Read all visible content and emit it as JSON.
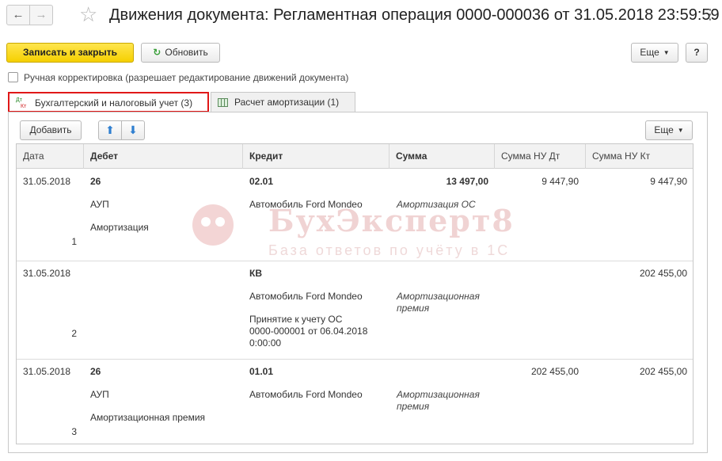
{
  "window": {
    "title": "Движения документа: Регламентная операция 0000-000036 от 31.05.2018 23:59:59",
    "nav_back": "←",
    "nav_forward": "→",
    "star": "☆",
    "close": "⋮"
  },
  "toolbar": {
    "save_close": "Записать и закрыть",
    "refresh": "Обновить",
    "refresh_icon": "↻",
    "more": "Еще",
    "help": "?"
  },
  "manual_edit": {
    "checked": false,
    "label": "Ручная корректировка (разрешает редактирование движений документа)"
  },
  "tabs": [
    {
      "label": "Бухгалтерский и налоговый учет (3)",
      "icon_dt": "Дт",
      "icon_kt": "Кт",
      "active": true
    },
    {
      "label": "Расчет амортизации (1)",
      "active": false
    }
  ],
  "table_toolbar": {
    "add": "Добавить",
    "up": "⬆",
    "down": "⬇",
    "more": "Еще"
  },
  "columns": [
    "Дата",
    "Дебет",
    "Кредит",
    "Сумма",
    "Сумма НУ Дт",
    "Сумма НУ Кт"
  ],
  "rows": [
    {
      "date": "31.05.2018",
      "num": "1",
      "debit": "26",
      "debit_sub1": "АУП",
      "debit_sub2": "Амортизация",
      "credit": "02.01",
      "credit_sub1": "Автомобиль Ford Mondeo",
      "credit_sub2": "",
      "sum": "13 497,00",
      "sum_note": "Амортизация ОС",
      "nu_dt": "9 447,90",
      "nu_kt": "9 447,90"
    },
    {
      "date": "31.05.2018",
      "num": "2",
      "debit": "",
      "debit_sub1": "",
      "debit_sub2": "",
      "credit": "КВ",
      "credit_sub1": "Автомобиль Ford Mondeo",
      "credit_sub2_l1": "Принятие к учету ОС",
      "credit_sub2_l2": "0000-000001 от 06.04.2018",
      "credit_sub2_l3": "0:00:00",
      "sum": "",
      "sum_note_l1": "Амортизационная",
      "sum_note_l2": "премия",
      "nu_dt": "",
      "nu_kt": "202 455,00"
    },
    {
      "date": "31.05.2018",
      "num": "3",
      "debit": "26",
      "debit_sub1": "АУП",
      "debit_sub2": "Амортизационная премия",
      "credit": "01.01",
      "credit_sub1": "Автомобиль Ford Mondeo",
      "sum": "",
      "sum_note_l1": "Амортизационная",
      "sum_note_l2": "премия",
      "nu_dt": "202 455,00",
      "nu_kt": "202 455,00"
    }
  ],
  "watermark": {
    "title": "БухЭксперт8",
    "subtitle": "База ответов по учёту в 1С"
  }
}
